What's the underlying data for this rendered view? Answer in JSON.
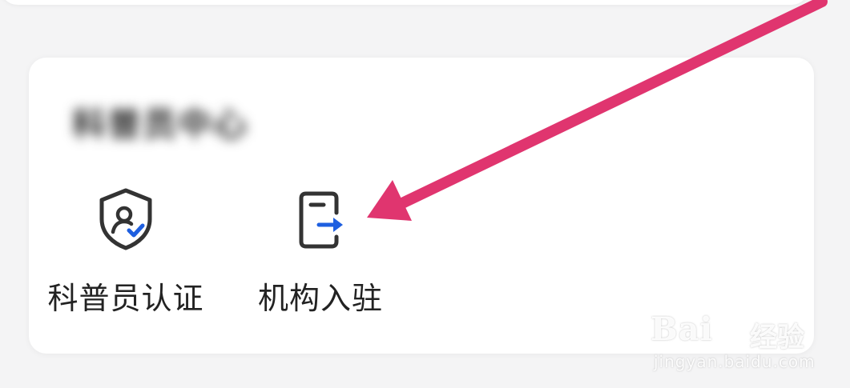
{
  "section": {
    "title": "科普员中心"
  },
  "entries": [
    {
      "label": "科普员认证",
      "icon": "shield-user-check-icon"
    },
    {
      "label": "机构入驻",
      "icon": "document-arrow-in-icon"
    }
  ],
  "annotation": {
    "icon": "pink-pointer-arrow",
    "color": "#e0356f"
  },
  "watermark": {
    "logo": "Bai",
    "suffix": "经验",
    "url": "jingyan.baidu.com"
  },
  "colors": {
    "accent": "#1e5fe0",
    "icon_dark": "#333333",
    "text": "#222222",
    "card": "#ffffff",
    "background": "#f4f4f5"
  }
}
